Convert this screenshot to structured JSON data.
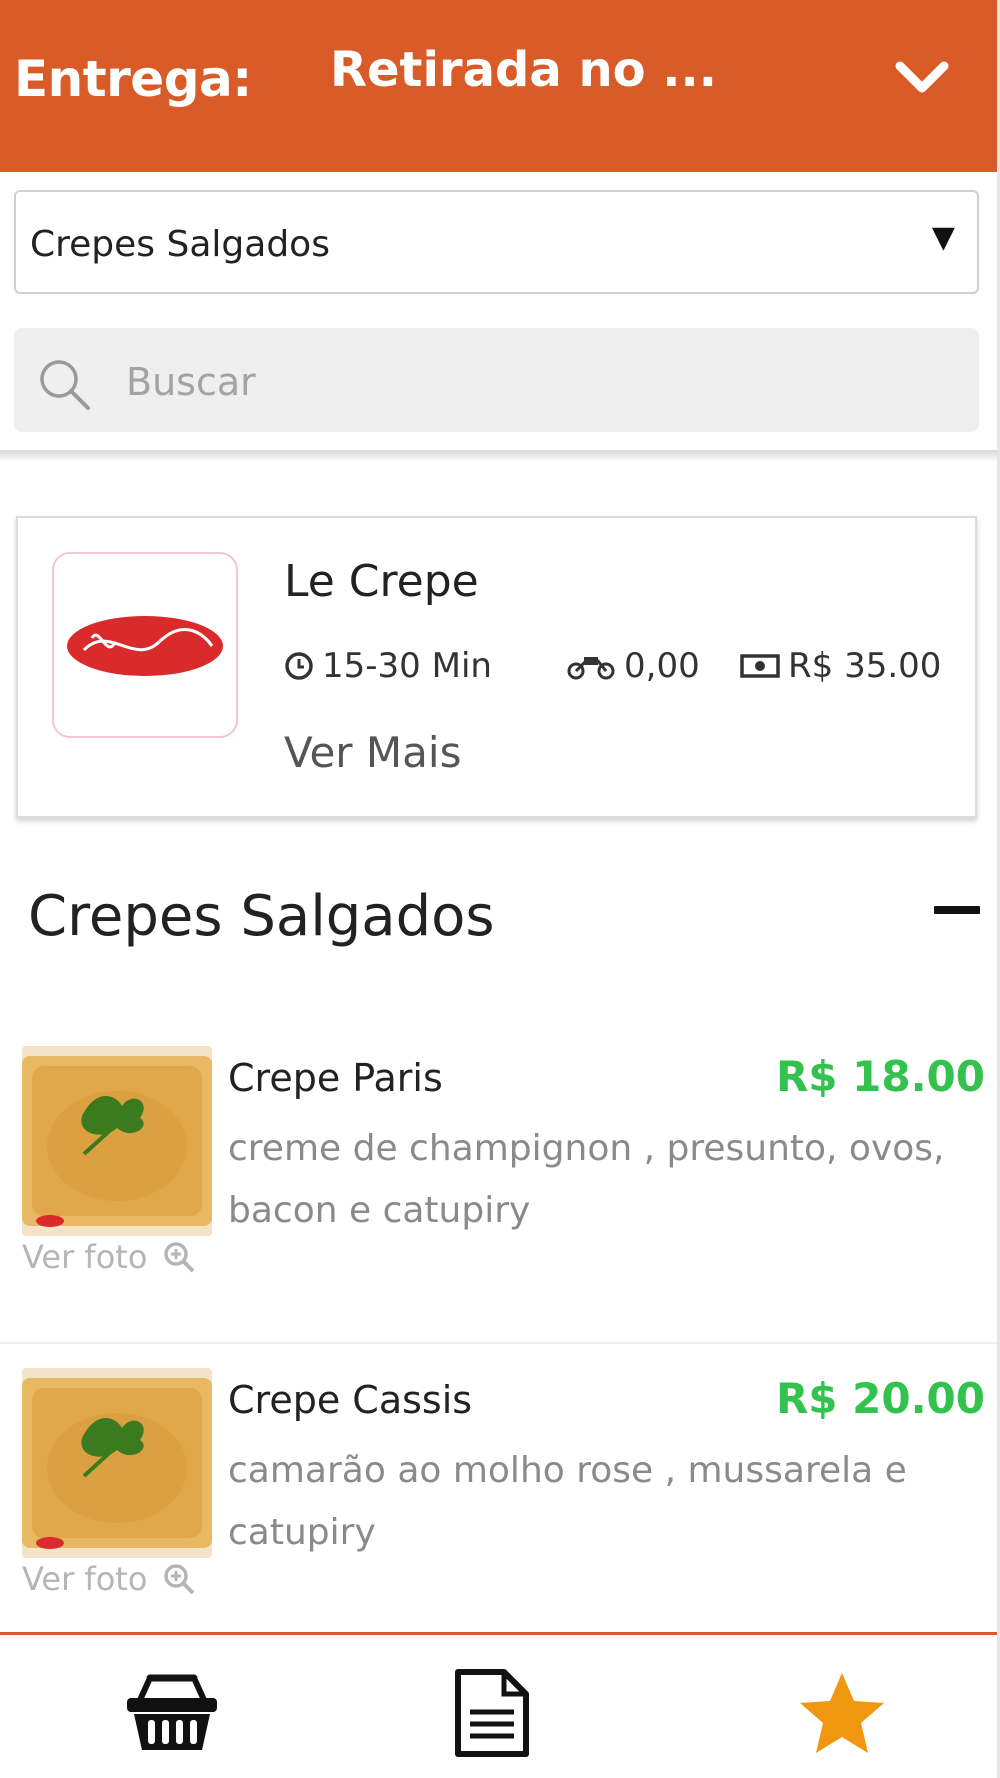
{
  "header": {
    "delivery_label": "Entrega:",
    "delivery_value": "Retirada no ...",
    "accent_color": "#d95b27"
  },
  "category_select": {
    "selected": "Crepes Salgados",
    "caret": "▼"
  },
  "search": {
    "placeholder": "Buscar"
  },
  "store": {
    "name": "Le Crepe",
    "logo_text": "Le Crêpe",
    "delivery_time": "15-30 Min",
    "delivery_fee": "0,00",
    "min_order": "R$ 35.00",
    "more_label": "Ver Mais"
  },
  "section": {
    "title": "Crepes Salgados"
  },
  "products": [
    {
      "name": "Crepe Paris",
      "price": "R$ 18.00",
      "description": "creme de champignon , presunto, ovos, bacon e catupiry",
      "photo_label": "Ver foto"
    },
    {
      "name": "Crepe Cassis",
      "price": "R$ 20.00",
      "description": "camarão ao molho rose , mussarela e catupiry",
      "photo_label": "Ver foto"
    }
  ],
  "bottom_nav": {
    "items": [
      "basket-icon",
      "document-icon",
      "star-icon"
    ],
    "star_color": "#f0960f"
  },
  "price_color": "#33c24d"
}
